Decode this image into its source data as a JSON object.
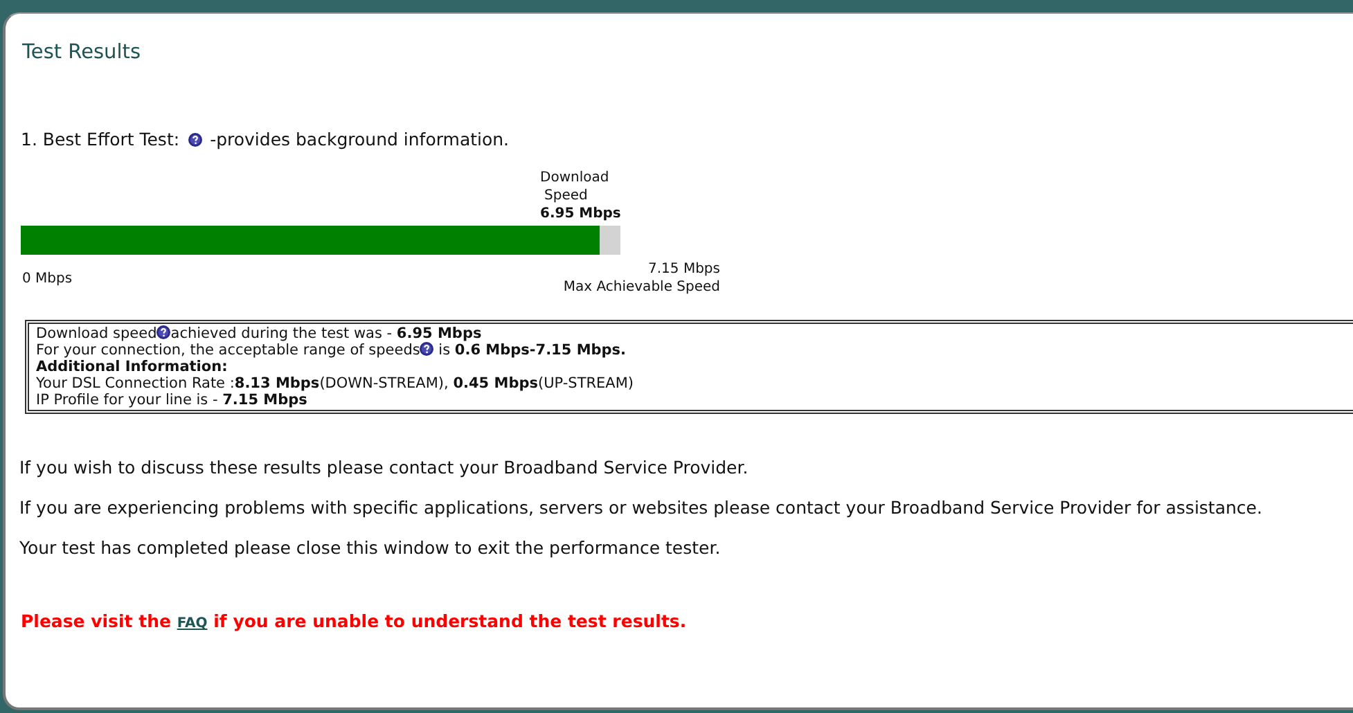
{
  "page_title": "Test Results",
  "test": {
    "heading": "1. Best Effort Test:",
    "help_note": "-provides background information."
  },
  "meter": {
    "caption_lines": [
      "Download",
      "Speed"
    ],
    "speed": "6.95 Mbps",
    "level": 0.965,
    "min_label": "0 Mbps",
    "max_value": "7.15 Mbps",
    "max_label": "Max Achievable Speed"
  },
  "info_lines": [
    {
      "kind": "help",
      "before": "Download speed",
      "after": "achieved during the test was - **6.95 Mbps**"
    },
    {
      "kind": "help",
      "before": "For your connection, the acceptable range of speeds",
      "after": " is **0.6 Mbps-7.15 Mbps.**"
    },
    {
      "kind": "heading",
      "text": "Additional Information:"
    },
    {
      "kind": "text",
      "text": "Your DSL Connection Rate :**8.13 Mbps**(DOWN-STREAM), **0.45 Mbps**(UP-STREAM)"
    },
    {
      "kind": "text",
      "text": "IP Profile for your line is - **7.15 Mbps**"
    }
  ],
  "paragraphs": [
    "If you wish to discuss these results please contact your Broadband Service Provider.",
    "If you are experiencing problems with specific applications, servers or websites please contact your Broadband Service Provider for assistance.",
    "Your test has completed please close this window to exit the performance tester."
  ],
  "notice": {
    "before": "Please visit the ",
    "link": "FAQ",
    "after": " if you are unable to understand the test results."
  }
}
